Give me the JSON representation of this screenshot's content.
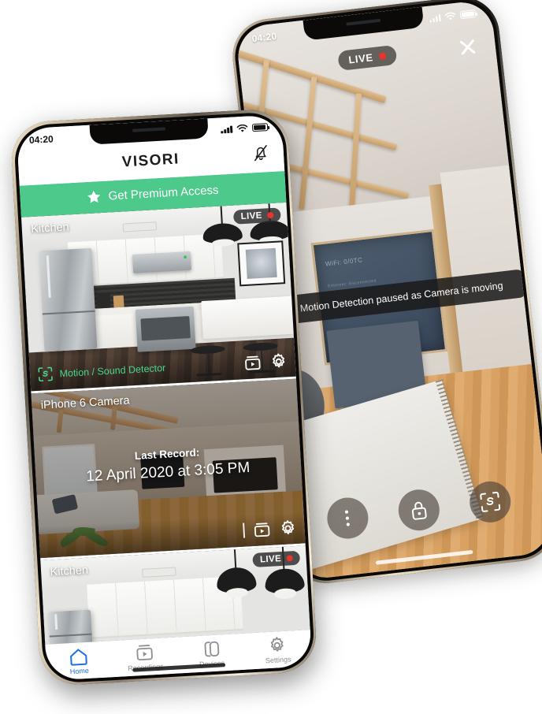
{
  "app": {
    "name": "VISORI"
  },
  "back_phone": {
    "status_bar": {
      "time": "04:20",
      "signal_icon": "signal-bars-icon",
      "wifi_icon": "wifi-icon",
      "battery_icon": "battery-icon"
    },
    "live_badge": {
      "label": "LIVE",
      "dot_color": "#e8342b"
    },
    "close_button": "close-icon",
    "toast": {
      "message": "Motion Detection paused as Camera is moving"
    },
    "controls": [
      {
        "name": "more-options-button",
        "icon": "dots-vertical-icon"
      },
      {
        "name": "lock-button",
        "icon": "lock-icon"
      },
      {
        "name": "motion-detector-button",
        "icon": "motion-scan-icon"
      }
    ],
    "scene": {
      "tv_text": "WiFi: 0/0TC",
      "tv_text_small": "Ethernet: disconnected"
    }
  },
  "front_phone": {
    "status_bar": {
      "time": "04:20",
      "signal_icon": "signal-bars-icon",
      "wifi_icon": "wifi-icon",
      "battery_icon": "battery-icon"
    },
    "header": {
      "title": "VISORI",
      "notification_icon": "bell-off-icon"
    },
    "premium_banner": {
      "label": "Get Premium Access",
      "icon": "star-icon",
      "color": "#4ec98c"
    },
    "cameras": [
      {
        "name": "Kitchen",
        "live": true,
        "live_label": "LIVE",
        "detector_label": "Motion / Sound Detector",
        "detector_icon": "motion-scan-icon",
        "detector_color": "#49d68c",
        "record_icon": "recordings-icon",
        "settings_icon": "gear-icon"
      },
      {
        "name": "iPhone 6 Camera",
        "live": false,
        "record_title": "Last Record:",
        "record_date": "12 April 2020 at 3:05 PM",
        "record_icon": "recordings-icon",
        "settings_icon": "gear-icon"
      },
      {
        "name": "Kitchen",
        "live": true,
        "live_label": "LIVE"
      }
    ],
    "tabs": [
      {
        "label": "Home",
        "icon": "home-icon",
        "active": true
      },
      {
        "label": "Recordings",
        "icon": "recordings-icon",
        "active": false
      },
      {
        "label": "Devices",
        "icon": "devices-icon",
        "active": false
      },
      {
        "label": "Settings",
        "icon": "gear-icon",
        "active": false
      }
    ]
  }
}
